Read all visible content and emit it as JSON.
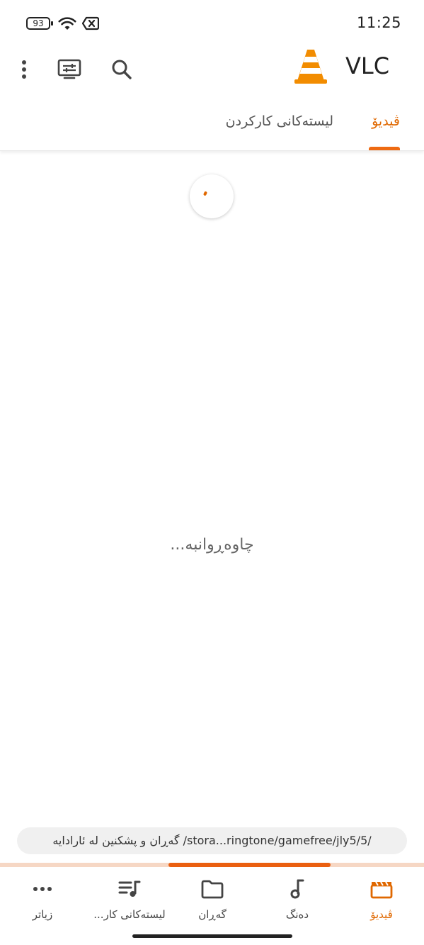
{
  "status_bar": {
    "battery_level": "93",
    "time": "11:25"
  },
  "toolbar": {
    "title": "VLC",
    "icons": [
      "more-vert-icon",
      "renderer-icon",
      "search-icon"
    ]
  },
  "tabs": {
    "video": "ڤیدیۆ",
    "playlists": "لیستەکانی کارکردن"
  },
  "main": {
    "loading_text": "چاوەڕوانبە..."
  },
  "scan": {
    "status_text": "گەڕان و پشکنین لە ئارادایە /stora...ringtone/gamefree/jly5/5/",
    "progress_start": 0.397,
    "progress_end": 0.78
  },
  "bottom_nav": {
    "video": "ڤیدیۆ",
    "audio": "دەنگ",
    "browse": "گەڕان",
    "playlists": "لیستەکانی کار...",
    "more": "زیاتر"
  },
  "colors": {
    "accent": "#e06800",
    "progress": "#ea5f10",
    "progress_track": "#f6d7c4"
  }
}
